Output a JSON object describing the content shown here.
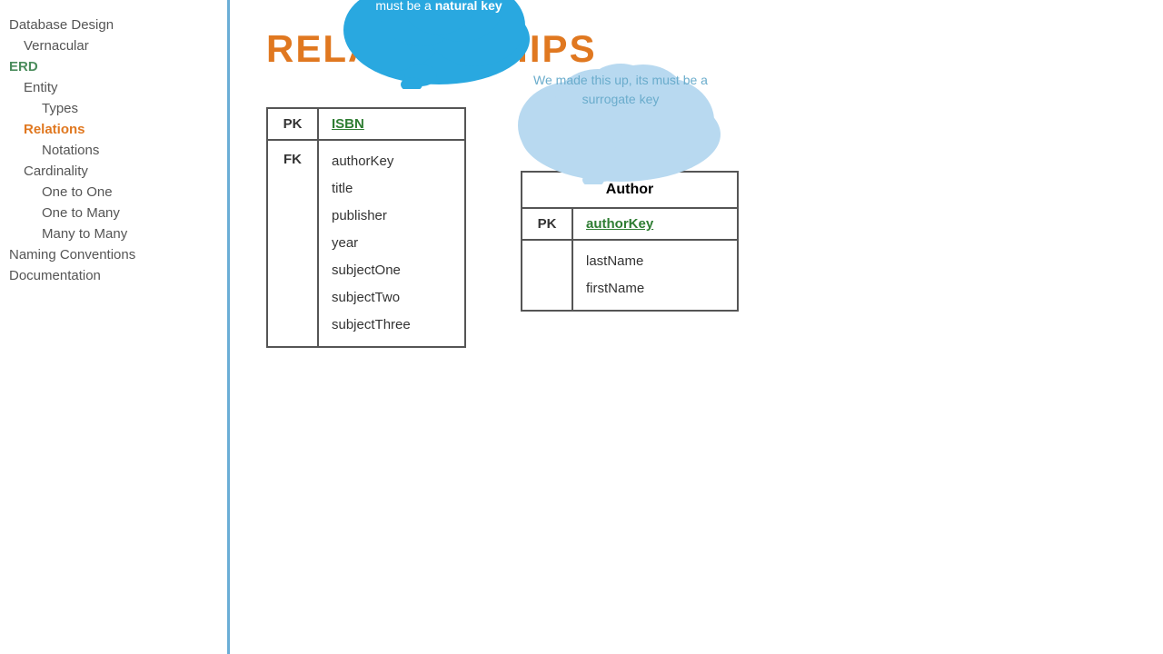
{
  "sidebar": {
    "items": [
      {
        "label": "Database Design",
        "level": 0,
        "style": "normal"
      },
      {
        "label": "Vernacular",
        "level": 1,
        "style": "normal"
      },
      {
        "label": "ERD",
        "level": 0,
        "style": "green"
      },
      {
        "label": "Entity",
        "level": 1,
        "style": "normal"
      },
      {
        "label": "Types",
        "level": 2,
        "style": "normal"
      },
      {
        "label": "Relations",
        "level": 1,
        "style": "active"
      },
      {
        "label": "Notations",
        "level": 2,
        "style": "normal"
      },
      {
        "label": "Cardinality",
        "level": 1,
        "style": "normal"
      },
      {
        "label": "One to One",
        "level": 2,
        "style": "normal"
      },
      {
        "label": "One to Many",
        "level": 2,
        "style": "normal"
      },
      {
        "label": "Many to Many",
        "level": 2,
        "style": "normal"
      },
      {
        "label": "Naming Conventions",
        "level": 0,
        "style": "normal"
      },
      {
        "label": "Documentation",
        "level": 0,
        "style": "normal"
      }
    ]
  },
  "page": {
    "title": "RELATIONSHIPS"
  },
  "left_table": {
    "pk_label": "PK",
    "pk_value": "ISBN",
    "fk_label": "FK",
    "fields": [
      "authorKey",
      "title",
      "publisher",
      "year",
      "subjectOne",
      "subjectTwo",
      "subjectThree"
    ]
  },
  "right_table": {
    "header": "Author",
    "pk_label": "PK",
    "pk_value": "authorKey",
    "fields": [
      "lastName",
      "firstName"
    ]
  },
  "cloud_dark": {
    "text": "We did not make this up… it must be a",
    "bold_text": "natural key"
  },
  "cloud_light": {
    "text": "We made this up, its must be a surrogate key"
  }
}
